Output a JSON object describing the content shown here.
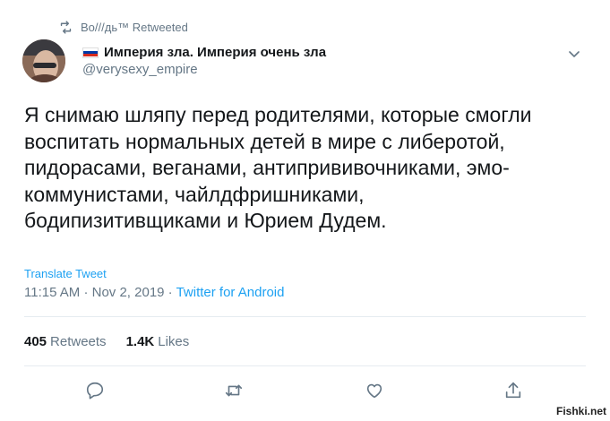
{
  "retweet": {
    "text": "Во///дь™ Retweeted"
  },
  "author": {
    "display_name": "Империя зла. Империя очень зла",
    "handle": "@verysexy_empire"
  },
  "tweet": {
    "text": "Я снимаю шляпу перед родителями, которые смогли\nвоспитать нормальных детей в мире с либеротой,\nпидорасами, веганами, антипрививочниками, эмо-\nкоммунистами, чайлдфришниками,\nбодипизитивщиками и Юрием Дудем.",
    "translate_label": "Translate Tweet",
    "time": "11:15 AM",
    "date": "Nov 2, 2019",
    "separator": "·",
    "source": "Twitter for Android"
  },
  "stats": {
    "retweets_count": "405",
    "retweets_label": "Retweets",
    "likes_count": "1.4K",
    "likes_label": "Likes"
  },
  "colors": {
    "accent": "#1da1f2",
    "secondary_text": "#657786",
    "primary_text": "#14171a"
  },
  "icons": [
    "retweet-icon",
    "flag-icon",
    "caret-down-icon",
    "reply-icon",
    "retweet-icon",
    "like-icon",
    "share-icon"
  ],
  "watermark": "Fishki.net"
}
